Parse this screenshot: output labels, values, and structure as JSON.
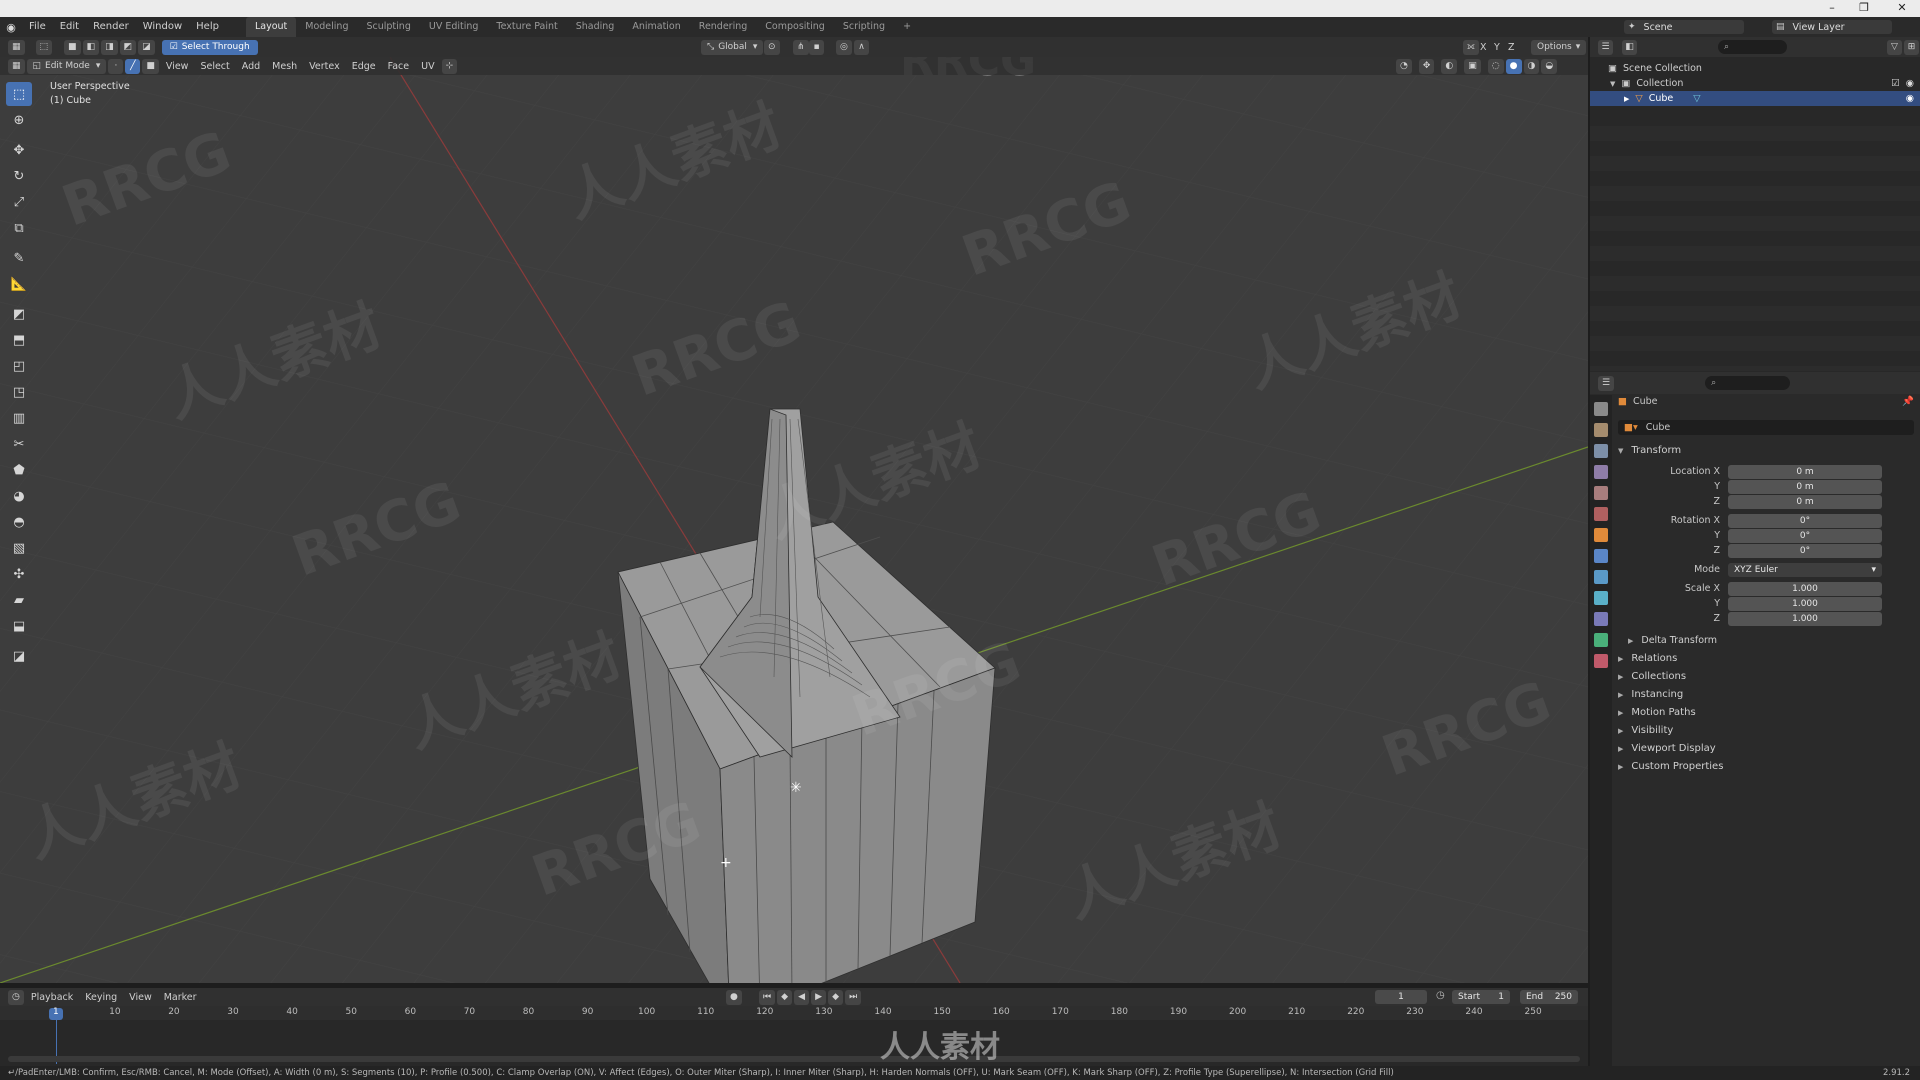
{
  "window": {
    "title_buttons": [
      "–",
      "❐",
      "✕"
    ]
  },
  "menu": {
    "items": [
      "File",
      "Edit",
      "Render",
      "Window",
      "Help"
    ]
  },
  "workspaces": [
    "Layout",
    "Modeling",
    "Sculpting",
    "UV Editing",
    "Texture Paint",
    "Shading",
    "Animation",
    "Rendering",
    "Compositing",
    "Scripting",
    "+"
  ],
  "scene": {
    "label": "Scene",
    "view_layer": "View Layer"
  },
  "tool_header": {
    "select_through": "Select Through",
    "orientation": "Global",
    "options": "Options",
    "axes": [
      "X",
      "Y",
      "Z"
    ]
  },
  "viewport_header": {
    "mode": "Edit Mode",
    "menus": [
      "View",
      "Select",
      "Add",
      "Mesh",
      "Vertex",
      "Edge",
      "Face",
      "UV"
    ]
  },
  "viewport": {
    "perspective": "User Perspective",
    "object": "(1) Cube"
  },
  "watermark": {
    "brand": "RRCG",
    "cn": "人人素材"
  },
  "outliner": {
    "rows": [
      {
        "label": "Scene Collection",
        "indent": 0,
        "selected": false
      },
      {
        "label": "Collection",
        "indent": 1,
        "selected": false
      },
      {
        "label": "Cube",
        "indent": 2,
        "selected": true
      }
    ]
  },
  "properties": {
    "object_name": "Cube",
    "data_name": "Cube",
    "transform_label": "Transform",
    "location_label": "Location X",
    "rotation_label": "Rotation X",
    "scale_label": "Scale X",
    "y_label": "Y",
    "z_label": "Z",
    "location": [
      "0 m",
      "0 m",
      "0 m"
    ],
    "rotation": [
      "0°",
      "0°",
      "0°"
    ],
    "mode_label": "Mode",
    "mode_value": "XYZ Euler",
    "scale": [
      "1.000",
      "1.000",
      "1.000"
    ],
    "delta_transform": "Delta Transform",
    "panels": [
      "Relations",
      "Collections",
      "Instancing",
      "Motion Paths",
      "Visibility",
      "Viewport Display",
      "Custom Properties"
    ]
  },
  "timeline": {
    "menus": [
      "Playback",
      "Keying",
      "View",
      "Marker"
    ],
    "current_frame": "1",
    "start_label": "Start",
    "start": "1",
    "end_label": "End",
    "end": "250",
    "ticks": [
      "1",
      "10",
      "20",
      "30",
      "40",
      "50",
      "60",
      "70",
      "80",
      "90",
      "100",
      "110",
      "120",
      "130",
      "140",
      "150",
      "160",
      "170",
      "180",
      "190",
      "200",
      "210",
      "220",
      "230",
      "240",
      "250"
    ]
  },
  "status": {
    "text": "↵/PadEnter/LMB: Confirm, Esc/RMB: Cancel, M: Mode (Offset), A: Width (0 m), S: Segments (10), P: Profile (0.500), C: Clamp Overlap (ON), V: Affect (Edges), O: Outer Miter (Sharp), I: Inner Miter (Sharp), H: Harden Normals (OFF), U: Mark Seam (OFF), K: Mark Sharp (OFF), Z: Profile Type (Superellipse), N: Intersection (Grid Fill)",
    "version": "2.91.2"
  },
  "colors": {
    "accent": "#4772b3",
    "x_axis": "#8a3b3b",
    "y_axis": "#6b8a2e",
    "viewport_bg": "#3d3d3d"
  }
}
